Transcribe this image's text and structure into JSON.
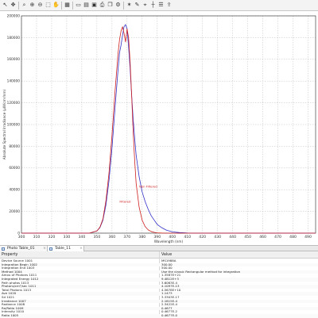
{
  "toolbar": {
    "tools": [
      "arrow-tool-icon",
      "move-tool-icon",
      "separator",
      "zoom-icon",
      "zoom-in-icon",
      "zoom-out-icon",
      "zoom-rect-icon",
      "hand-icon",
      "separator",
      "grid-toggle-icon",
      "separator",
      "select-icon",
      "table-icon",
      "save-icon",
      "print-icon",
      "copy-icon",
      "settings-icon",
      "separator",
      "peak-tool-icon",
      "annotate-icon",
      "marker-icon",
      "cursor-icon",
      "legend-icon",
      "export-icon"
    ]
  },
  "chart_data": {
    "type": "line",
    "xlabel": "Wavelength (nm)",
    "ylabel": "Absolute Spectral Irradiance (µW/cm²/nm)",
    "xlim": [
      300,
      495
    ],
    "ylim": [
      0,
      200000
    ],
    "xticks": [
      300,
      310,
      320,
      330,
      340,
      350,
      360,
      370,
      380,
      390,
      400,
      410,
      420,
      430,
      440,
      450,
      460,
      470,
      480,
      490
    ],
    "yticks": [
      0,
      20000,
      40000,
      60000,
      80000,
      100000,
      120000,
      140000,
      160000,
      180000,
      200000
    ],
    "grid": true,
    "series": [
      {
        "name": "Non Filtered",
        "color": "#3030c8",
        "x": [
          300,
          345,
          350,
          352,
          354,
          356,
          358,
          360,
          362,
          364,
          365,
          366,
          367,
          368,
          369,
          370,
          371,
          372,
          373,
          374,
          375,
          376,
          378,
          380,
          382,
          384,
          386,
          388,
          390,
          393,
          396,
          400,
          405,
          410,
          420,
          495
        ],
        "y": [
          0,
          0,
          2000,
          5000,
          12000,
          26000,
          48000,
          78000,
          115000,
          150000,
          166000,
          173000,
          182000,
          190000,
          192000,
          188000,
          172000,
          152000,
          128000,
          106000,
          88000,
          72000,
          52000,
          38000,
          29000,
          22000,
          16000,
          12000,
          8000,
          5000,
          2800,
          1200,
          500,
          200,
          0,
          0
        ]
      },
      {
        "name": "Filtered",
        "color": "#d02020",
        "x": [
          300,
          345,
          350,
          352,
          354,
          356,
          358,
          360,
          362,
          364,
          365,
          366,
          367,
          368,
          369,
          370,
          371,
          372,
          373,
          374,
          375,
          376,
          378,
          380,
          382,
          384,
          386,
          388,
          390,
          395,
          400,
          495
        ],
        "y": [
          0,
          0,
          2000,
          5500,
          13000,
          30000,
          55000,
          90000,
          130000,
          165000,
          178000,
          186000,
          190000,
          184000,
          176000,
          188000,
          180000,
          158000,
          128000,
          95000,
          68000,
          46000,
          24000,
          12000,
          6000,
          3000,
          1500,
          700,
          300,
          0,
          0,
          0
        ]
      }
    ],
    "annotations": [
      {
        "text": "Non Filtered",
        "x": 378,
        "y": 42000,
        "color": "#d02020"
      },
      {
        "text": "Filtered",
        "x": 365,
        "y": 28000,
        "color": "#d02020"
      }
    ]
  },
  "tabs": [
    {
      "label": "Photo Table_01",
      "active": false
    },
    {
      "label": "Table_11",
      "active": true
    }
  ],
  "grid": {
    "header_property": "Property",
    "header_value": "Value",
    "rows": [
      {
        "property": "Device Source 1001",
        "value": "MS1988A"
      },
      {
        "property": "Integration Begin 1002",
        "value": "300.00"
      },
      {
        "property": "Integration End 1003",
        "value": "500.00"
      },
      {
        "property": "Method 1004",
        "value": "Use the classic Rectangular method for integration"
      },
      {
        "property": "Amou of Photons 1011",
        "value": "1.3587E+21"
      },
      {
        "property": "Integrated Energy 1012",
        "value": "9.4812E+3"
      },
      {
        "property": "Path photos 1013",
        "value": "3.6063E-4"
      },
      {
        "property": "Photons/cm²/sec 1011",
        "value": "4.1097E-13"
      },
      {
        "property": "Total Photons 1013",
        "value": "4.5678E+10"
      },
      {
        "property": "Ave 1020",
        "value": "1.1473"
      },
      {
        "property": "Sd 1021",
        "value": "3.3303E-17"
      },
      {
        "property": "Irradiance 1007",
        "value": "2.1815E-4"
      },
      {
        "property": "Radiance 1008",
        "value": "2.3422E-4"
      },
      {
        "property": "Ra/Ratio 1009",
        "value": "0.4677"
      },
      {
        "property": "Intensity 1010",
        "value": "0.4677E-2"
      },
      {
        "property": "Ratio 1005",
        "value": "0.4677E-0"
      }
    ]
  }
}
